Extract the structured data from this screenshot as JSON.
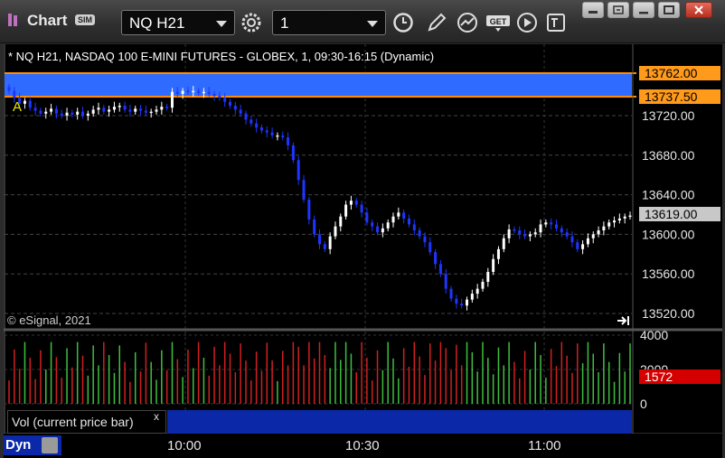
{
  "window": {
    "title": "Chart",
    "sim_badge": "SIM",
    "symbol": "NQ H21",
    "interval": "1"
  },
  "chart": {
    "header": "* NQ H21, NASDAQ 100 E-MINI FUTURES - GLOBEX, 1, 09:30-16:15 (Dynamic)",
    "copyright": "© eSignal, 2021",
    "marker_label": "A",
    "volume_label": "Vol (current price bar)",
    "volume_close": "x",
    "dynamic_label": "Dyn",
    "price_axis": [
      "13720.00",
      "13680.00",
      "13640.00",
      "13600.00",
      "13560.00",
      "13520.00"
    ],
    "volume_axis": [
      "4000",
      "2000",
      "0"
    ],
    "time_axis": [
      "10:00",
      "10:30",
      "11:00"
    ],
    "range_high": "13762.00",
    "range_low": "13737.50",
    "last_price": "13619.00",
    "last_volume": "1572",
    "colors": {
      "range_band": "#2f6bff",
      "range_tag": "#ff9a1a",
      "last_tag": "#c8c8c8",
      "volume_tag": "#d40000",
      "up_candle": "#ffffff",
      "down_candle": "#1e35ff",
      "vol_up": "#3fbf3f",
      "vol_down": "#d02020"
    }
  },
  "chart_data": {
    "type": "candlestick",
    "x_axis": "time (1-minute bars, 09:30 onward)",
    "ylim": [
      13500,
      13770
    ],
    "close_series": [
      13745,
      13738,
      13732,
      13735,
      13728,
      13725,
      13722,
      13724,
      13727,
      13722,
      13720,
      13723,
      13721,
      13724,
      13720,
      13722,
      13726,
      13728,
      13724,
      13726,
      13729,
      13730,
      13726,
      13724,
      13727,
      13725,
      13723,
      13724,
      13726,
      13729,
      13728,
      13744,
      13742,
      13745,
      13744,
      13745,
      13743,
      13744,
      13742,
      13740,
      13738,
      13734,
      13730,
      13726,
      13722,
      13716,
      13712,
      13708,
      13705,
      13703,
      13700,
      13700,
      13698,
      13690,
      13675,
      13655,
      13635,
      13615,
      13600,
      13590,
      13585,
      13598,
      13608,
      13618,
      13630,
      13634,
      13630,
      13622,
      13612,
      13608,
      13602,
      13606,
      13612,
      13618,
      13622,
      13616,
      13610,
      13604,
      13598,
      13592,
      13582,
      13570,
      13560,
      13545,
      13535,
      13530,
      13528,
      13534,
      13540,
      13545,
      13552,
      13562,
      13575,
      13585,
      13596,
      13605,
      13604,
      13600,
      13598,
      13600,
      13602,
      13610,
      13612,
      13610,
      13606,
      13602,
      13598,
      13592,
      13585,
      13590,
      13596,
      13600,
      13604,
      13608,
      13612,
      13614,
      13616,
      13618,
      13619
    ],
    "volume_scale": [
      0,
      4000
    ]
  }
}
